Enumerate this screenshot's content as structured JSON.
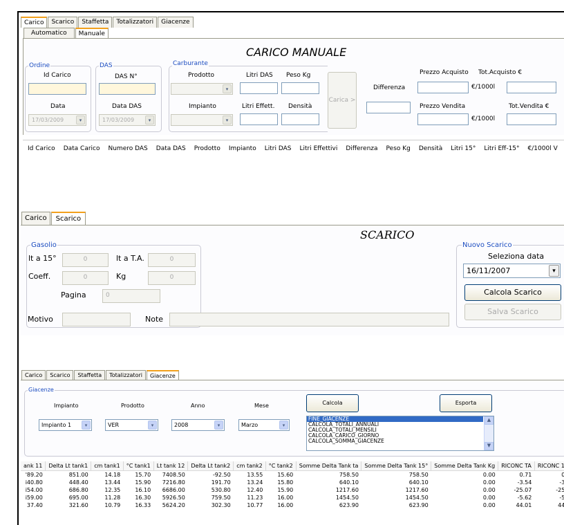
{
  "panel1": {
    "tabs": [
      "Carico",
      "Scarico",
      "Staffetta",
      "Totalizzatori",
      "Giacenze"
    ],
    "subtabs": [
      "Automatico",
      "Manuale"
    ],
    "title": "CARICO MANUALE",
    "ordine": {
      "label": "Ordine",
      "id_label": "Id Carico",
      "data_label": "Data",
      "data_value": "17/03/2009"
    },
    "das": {
      "label": "DAS",
      "num_label": "DAS N°",
      "data_label": "Data DAS",
      "data_value": "17/03/2009"
    },
    "carburante": {
      "label": "Carburante",
      "prodotto_label": "Prodotto",
      "impianto_label": "Impianto",
      "litri_das": "Litri DAS",
      "peso_kg": "Peso Kg",
      "litri_effett": "Litri Effett.",
      "densita": "Densità"
    },
    "carica_button": "Carica >",
    "differenza": "Differenza",
    "prezzo_acquisto": "Prezzo Acquisto",
    "tot_acquisto": "Tot.Acquisto €",
    "prezzo_vendita": "Prezzo Vendita",
    "tot_vendita": "Tot.Vendita €",
    "unit": "€/1000l",
    "columns": [
      "Id Carico",
      "Data Carico",
      "Numero DAS",
      "Data DAS",
      "Prodotto",
      "Impianto",
      "Litri DAS",
      "Litri Effettivi",
      "Differenza",
      "Peso Kg",
      "Densità",
      "Litri 15°",
      "Litri Eff-15°",
      "€/1000l V"
    ]
  },
  "panel2": {
    "tabs": [
      "Carico",
      "Scarico"
    ],
    "title": "SCARICO",
    "gasolio": {
      "label": "Gasolio",
      "lt15": "lt a 15°",
      "lt15_val": "0",
      "ltta": "lt a T.A.",
      "ltta_val": "0",
      "coeff": "Coeff.",
      "coeff_val": "0",
      "kg": "Kg",
      "kg_val": "0",
      "pagina": "Pagina",
      "pagina_val": "0"
    },
    "motivo": "Motivo",
    "note": "Note",
    "nuovo": {
      "label": "Nuovo Scarico",
      "seleziona": "Seleziona data",
      "date": "16/11/2007",
      "calcola": "Calcola Scarico",
      "salva": "Salva Scarico"
    }
  },
  "panel3": {
    "tabs": [
      "Carico",
      "Scarico",
      "Staffetta",
      "Totalizzatori",
      "Giacenze"
    ],
    "group": "Giacenze",
    "impianto_label": "Impianto",
    "impianto_val": "Impianto 1",
    "prodotto_label": "Prodotto",
    "prodotto_val": "VER",
    "anno_label": "Anno",
    "anno_val": "2008",
    "mese_label": "Mese",
    "mese_val": "Marzo",
    "calcola": "Calcola",
    "esporta": "Esporta",
    "list": [
      "FINE_GIACENZE",
      "CALCOLA_TOTALI_ANNUALI",
      "CALCOLA_TOTALI_MENSILI",
      "CALCOLA_CARICO_GIORNO",
      "CALCOLA_SOMMA_GIACENZE"
    ],
    "columns": [
      "ank 11",
      "Delta Lt tank1",
      "cm tank1",
      "°C tank1",
      "Lt tank 12",
      "Delta Lt tank2",
      "cm tank2",
      "°C tank2",
      "Somme Delta Tank ta",
      "Somme Delta Tank 15°",
      "Somme Delta Tank Kg",
      "RICONC TA",
      "RICONC 1"
    ],
    "rows": [
      [
        "'89.20",
        "851.00",
        "14.18",
        "15.70",
        "7408.50",
        "-92.50",
        "13.55",
        "15.60",
        "758.50",
        "758.50",
        "0.00",
        "0.71",
        "0"
      ],
      [
        "i40.80",
        "448.40",
        "13.44",
        "15.90",
        "7216.80",
        "191.70",
        "13.24",
        "15.80",
        "640.10",
        "640.10",
        "0.00",
        "-3.54",
        "-3"
      ],
      [
        "i54.00",
        "686.80",
        "12.35",
        "16.10",
        "6686.00",
        "530.80",
        "12.40",
        "15.90",
        "1217.60",
        "1217.60",
        "0.00",
        "-25.07",
        "-25"
      ],
      [
        "i59.00",
        "695.00",
        "11.28",
        "16.30",
        "5926.50",
        "759.50",
        "11.23",
        "16.00",
        "1454.50",
        "1454.50",
        "0.00",
        "-5.62",
        "-5"
      ],
      [
        "37.40",
        "321.60",
        "10.79",
        "16.33",
        "5624.20",
        "302.30",
        "10.77",
        "16.00",
        "623.90",
        "623.90",
        "0.00",
        "44.01",
        "44"
      ]
    ]
  }
}
